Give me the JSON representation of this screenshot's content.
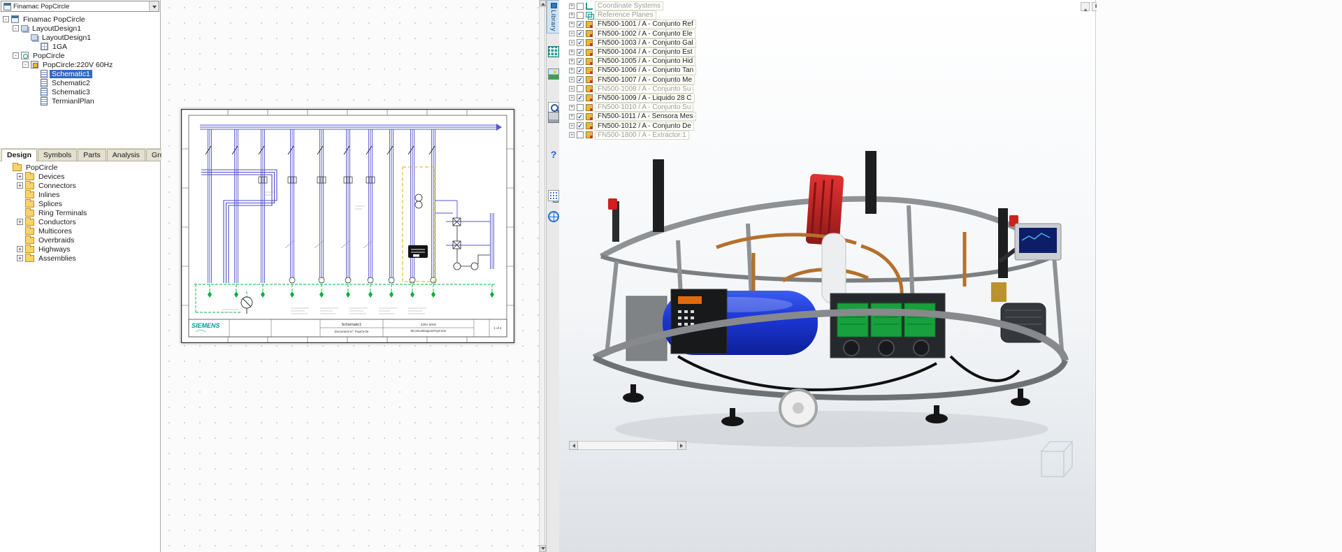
{
  "left_panel": {
    "project_selector": {
      "value": "Finamac PopCircle"
    },
    "project_tree": [
      {
        "label": "Finamac PopCircle",
        "exp": "-"
      },
      {
        "label": "LayoutDesign1",
        "exp": "-"
      },
      {
        "label": "LayoutDesign1",
        "exp": ""
      },
      {
        "label": "1GA",
        "exp": ""
      },
      {
        "label": "PopCircle",
        "exp": "-"
      },
      {
        "label": "PopCircle:220V 60Hz",
        "exp": "-"
      },
      {
        "label": "Schematic1",
        "exp": "",
        "selected": true
      },
      {
        "label": "Schematic2",
        "exp": ""
      },
      {
        "label": "Schematic3",
        "exp": ""
      },
      {
        "label": "TermianlPlan",
        "exp": ""
      }
    ],
    "tabs": [
      {
        "label": "Design",
        "active": true
      },
      {
        "label": "Symbols",
        "active": false
      },
      {
        "label": "Parts",
        "active": false
      },
      {
        "label": "Analysis",
        "active": false
      },
      {
        "label": "Groups",
        "active": false
      }
    ],
    "design_tree": [
      {
        "label": "PopCircle",
        "exp": ""
      },
      {
        "label": "Devices",
        "exp": "+"
      },
      {
        "label": "Connectors",
        "exp": "+"
      },
      {
        "label": "Inlines",
        "exp": ""
      },
      {
        "label": "Splices",
        "exp": ""
      },
      {
        "label": "Ring Terminals",
        "exp": ""
      },
      {
        "label": "Conductors",
        "exp": "+"
      },
      {
        "label": "Multicores",
        "exp": ""
      },
      {
        "label": "Overbraids",
        "exp": ""
      },
      {
        "label": "Highways",
        "exp": "+"
      },
      {
        "label": "Assemblies",
        "exp": "+"
      }
    ]
  },
  "library_tab": {
    "label": "Library"
  },
  "schematic": {
    "title_block": {
      "brand": "SIEMENS",
      "sheet_title": "Schematic1",
      "doc_line": "Document N°: PopCircle",
      "voltage_line": "220V 60Hz",
      "project_line": "ElectricalDiagramPopCircle",
      "page": "1 of 4"
    }
  },
  "feature_tree": {
    "rows": [
      {
        "label": "Coordinate Systems",
        "check": "",
        "dimmed": true
      },
      {
        "label": "Reference Planes",
        "check": "",
        "dimmed": true
      },
      {
        "label": "FN500-1001 / A - Conjunto Ref",
        "check": "✓",
        "dimmed": false
      },
      {
        "label": "FN500-1002 / A - Conjunto Ele",
        "check": "✓",
        "dimmed": false
      },
      {
        "label": "FN500-1003 / A - Conjunto Gal",
        "check": "✓",
        "dimmed": false
      },
      {
        "label": "FN500-1004 / A - Conjunto Est",
        "check": "✓",
        "dimmed": false
      },
      {
        "label": "FN500-1005 / A - Conjunto Hid",
        "check": "✓",
        "dimmed": false
      },
      {
        "label": "FN500-1006 / A - Conjunto Tan",
        "check": "✓",
        "dimmed": false
      },
      {
        "label": "FN500-1007 / A - Conjunto Me",
        "check": "✓",
        "dimmed": false
      },
      {
        "label": "FN500-1008 / A - Conjunto Su",
        "check": "",
        "dimmed": true
      },
      {
        "label": "FN500-1009 / A - Liquido 28 C",
        "check": "✓",
        "dimmed": false
      },
      {
        "label": "FN500-1010 / A - Conjunto Su",
        "check": "",
        "dimmed": true
      },
      {
        "label": "FN500-1011 / A - Sensora Mes",
        "check": "✓",
        "dimmed": false
      },
      {
        "label": "FN500-1012 / A - Conjunto De",
        "check": "✓",
        "dimmed": false
      },
      {
        "label": "FN500-1800 / A - Extractor:1",
        "check": "",
        "dimmed": true
      }
    ]
  },
  "colors": {
    "selection_blue": "#316ac5",
    "siemens_teal": "#009c9c",
    "schematic_blue": "#5656cc",
    "dashed_green": "#00b33c",
    "dashed_orange": "#f0a500",
    "check_blue": "#2d50b8"
  }
}
